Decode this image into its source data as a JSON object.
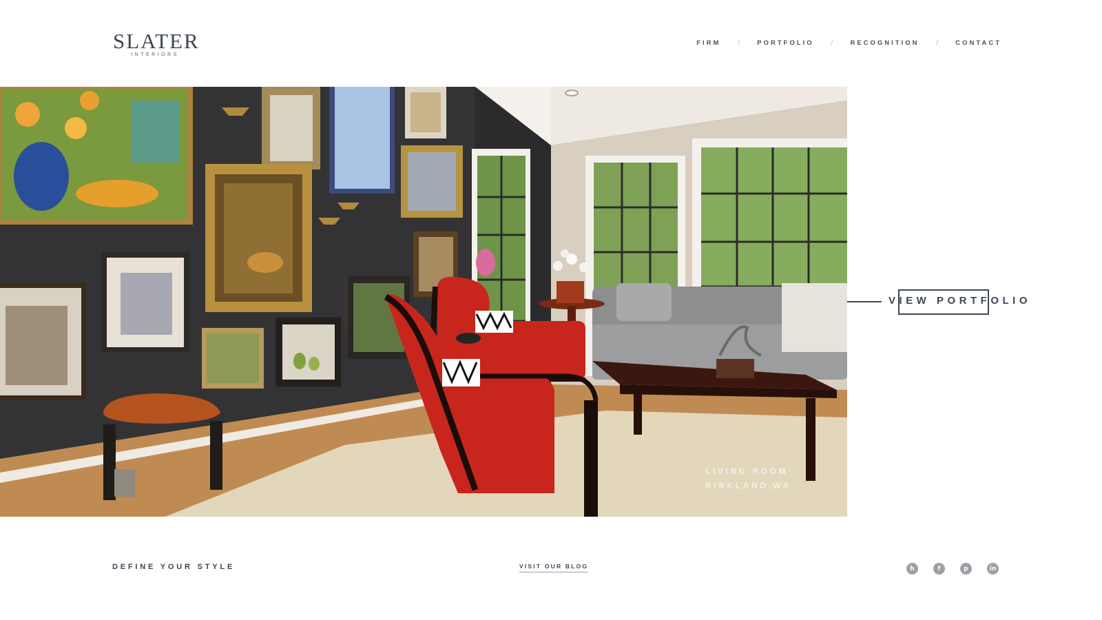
{
  "brand": {
    "name": "SLATER",
    "sub": "INTERIORS"
  },
  "nav": {
    "items": [
      "FIRM",
      "PORTFOLIO",
      "RECOGNITION",
      "CONTACT"
    ],
    "separator": "/"
  },
  "hero": {
    "caption_line1": "LIVING ROOM",
    "caption_line2": "KIRKLAND,WA",
    "cta": "VIEW PORTFOLIO"
  },
  "footer": {
    "tagline": "DEFINE YOUR STYLE",
    "blog_link": "VISIT OUR BLOG",
    "social": [
      {
        "icon": "houzz-icon",
        "glyph": "h"
      },
      {
        "icon": "facebook-icon",
        "glyph": "f"
      },
      {
        "icon": "pinterest-icon",
        "glyph": "p"
      },
      {
        "icon": "linkedin-icon",
        "glyph": "in"
      }
    ]
  },
  "colors": {
    "text": "#3d4654",
    "icon_gray": "#9da1a6",
    "accent_red": "#c8261c"
  }
}
